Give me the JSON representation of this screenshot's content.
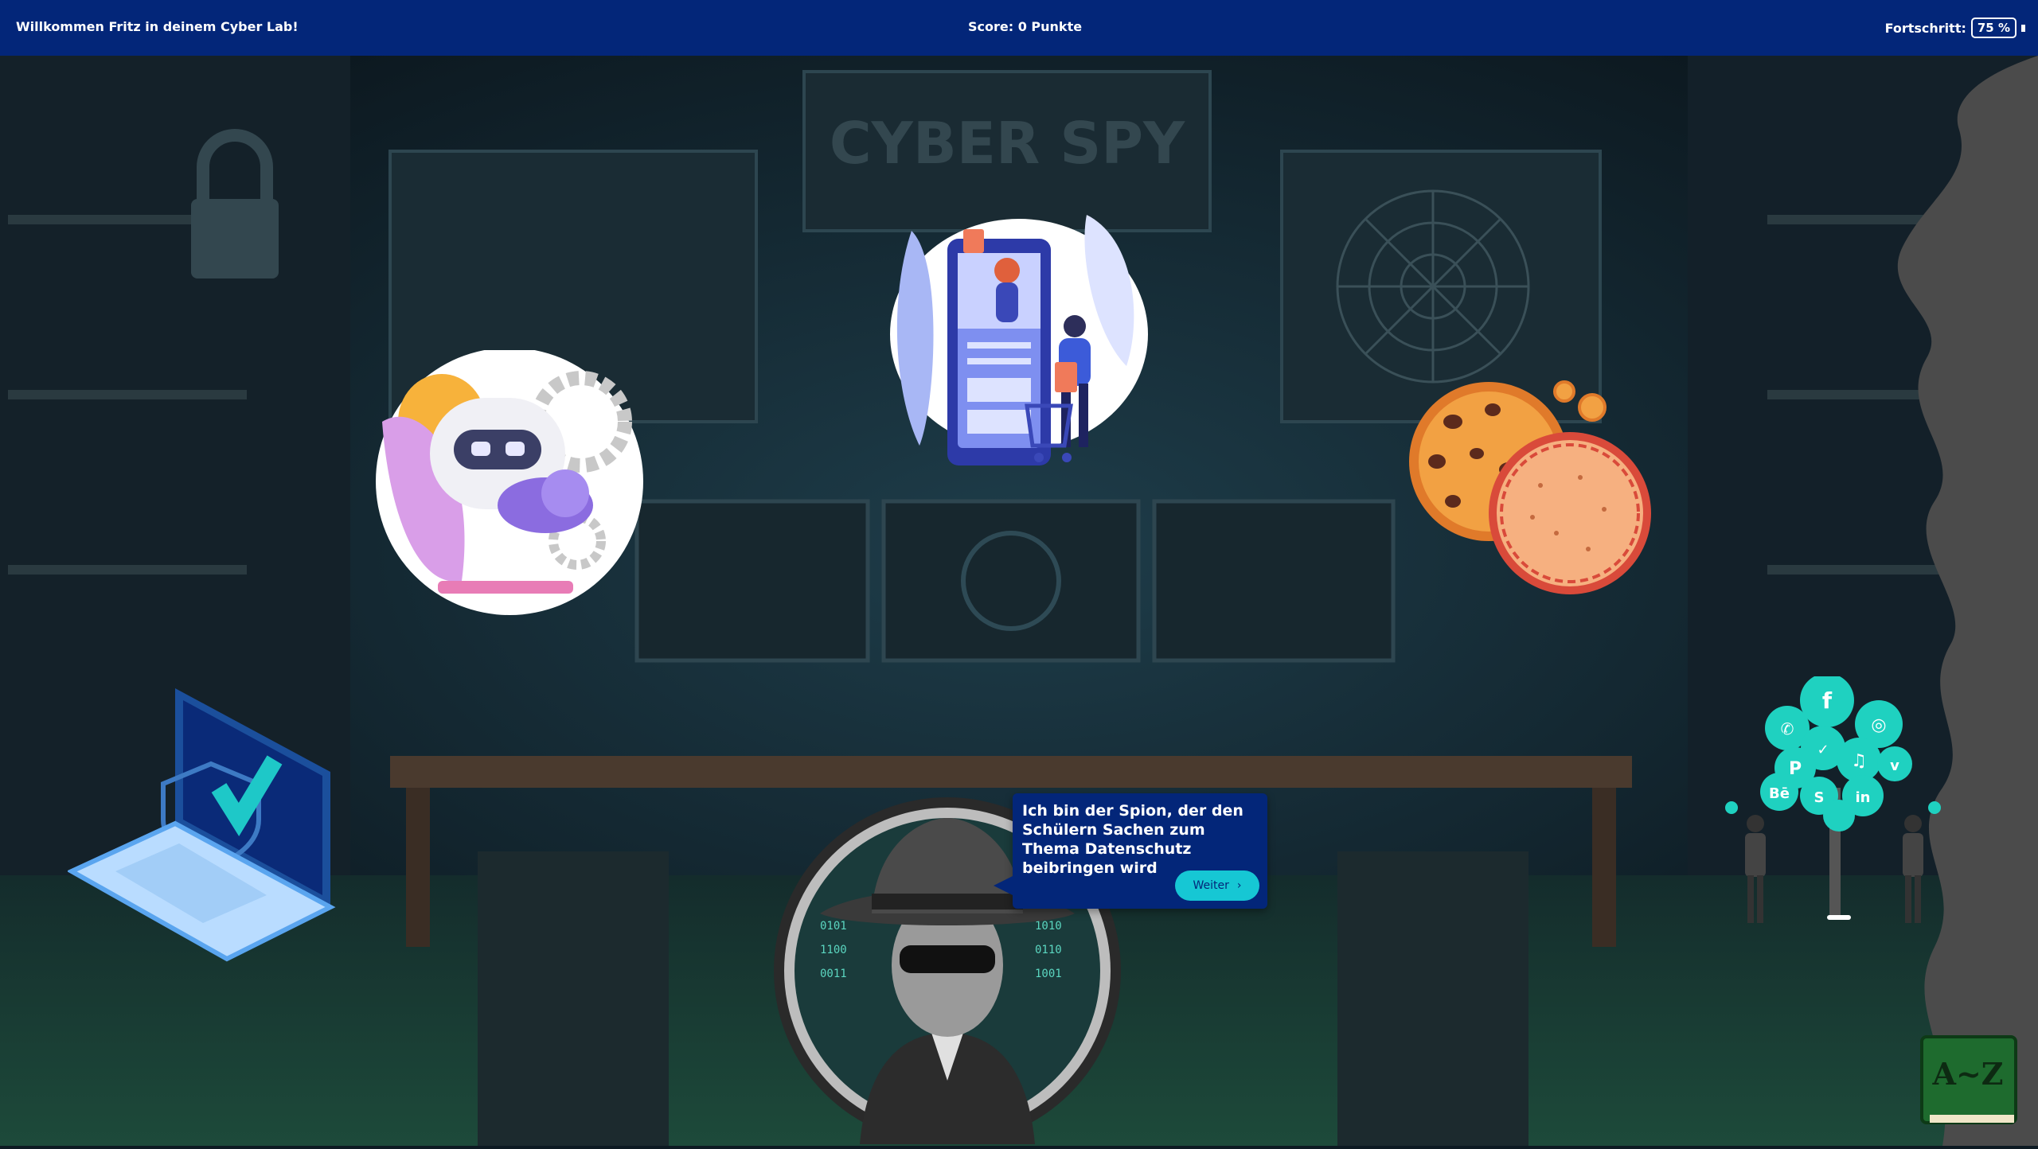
{
  "header": {
    "welcome_text": "Willkommen Fritz in deinem Cyber Lab!",
    "score_text": "Score: 0 Punkte",
    "progress_label": "Fortschritt:",
    "progress_value": "75 %"
  },
  "room": {
    "wall_sign": "CYBER SPY"
  },
  "speech_bubble": {
    "text": "Ich bin der Spion, der den Schülern Sachen zum Thema Datenschutz beibringen wird",
    "button_label": "Weiter",
    "button_icon": "chevron-right-icon"
  },
  "glossary_book": {
    "label": "A~Z"
  },
  "social_tree_icons": [
    "f",
    "◎",
    "✆",
    "✓",
    "♫",
    "P",
    "v",
    "Bē",
    "S",
    "in"
  ],
  "colors": {
    "header_bg": "#032679",
    "accent_cyan": "#16c7d4",
    "room_dark": "#0d1a22"
  }
}
